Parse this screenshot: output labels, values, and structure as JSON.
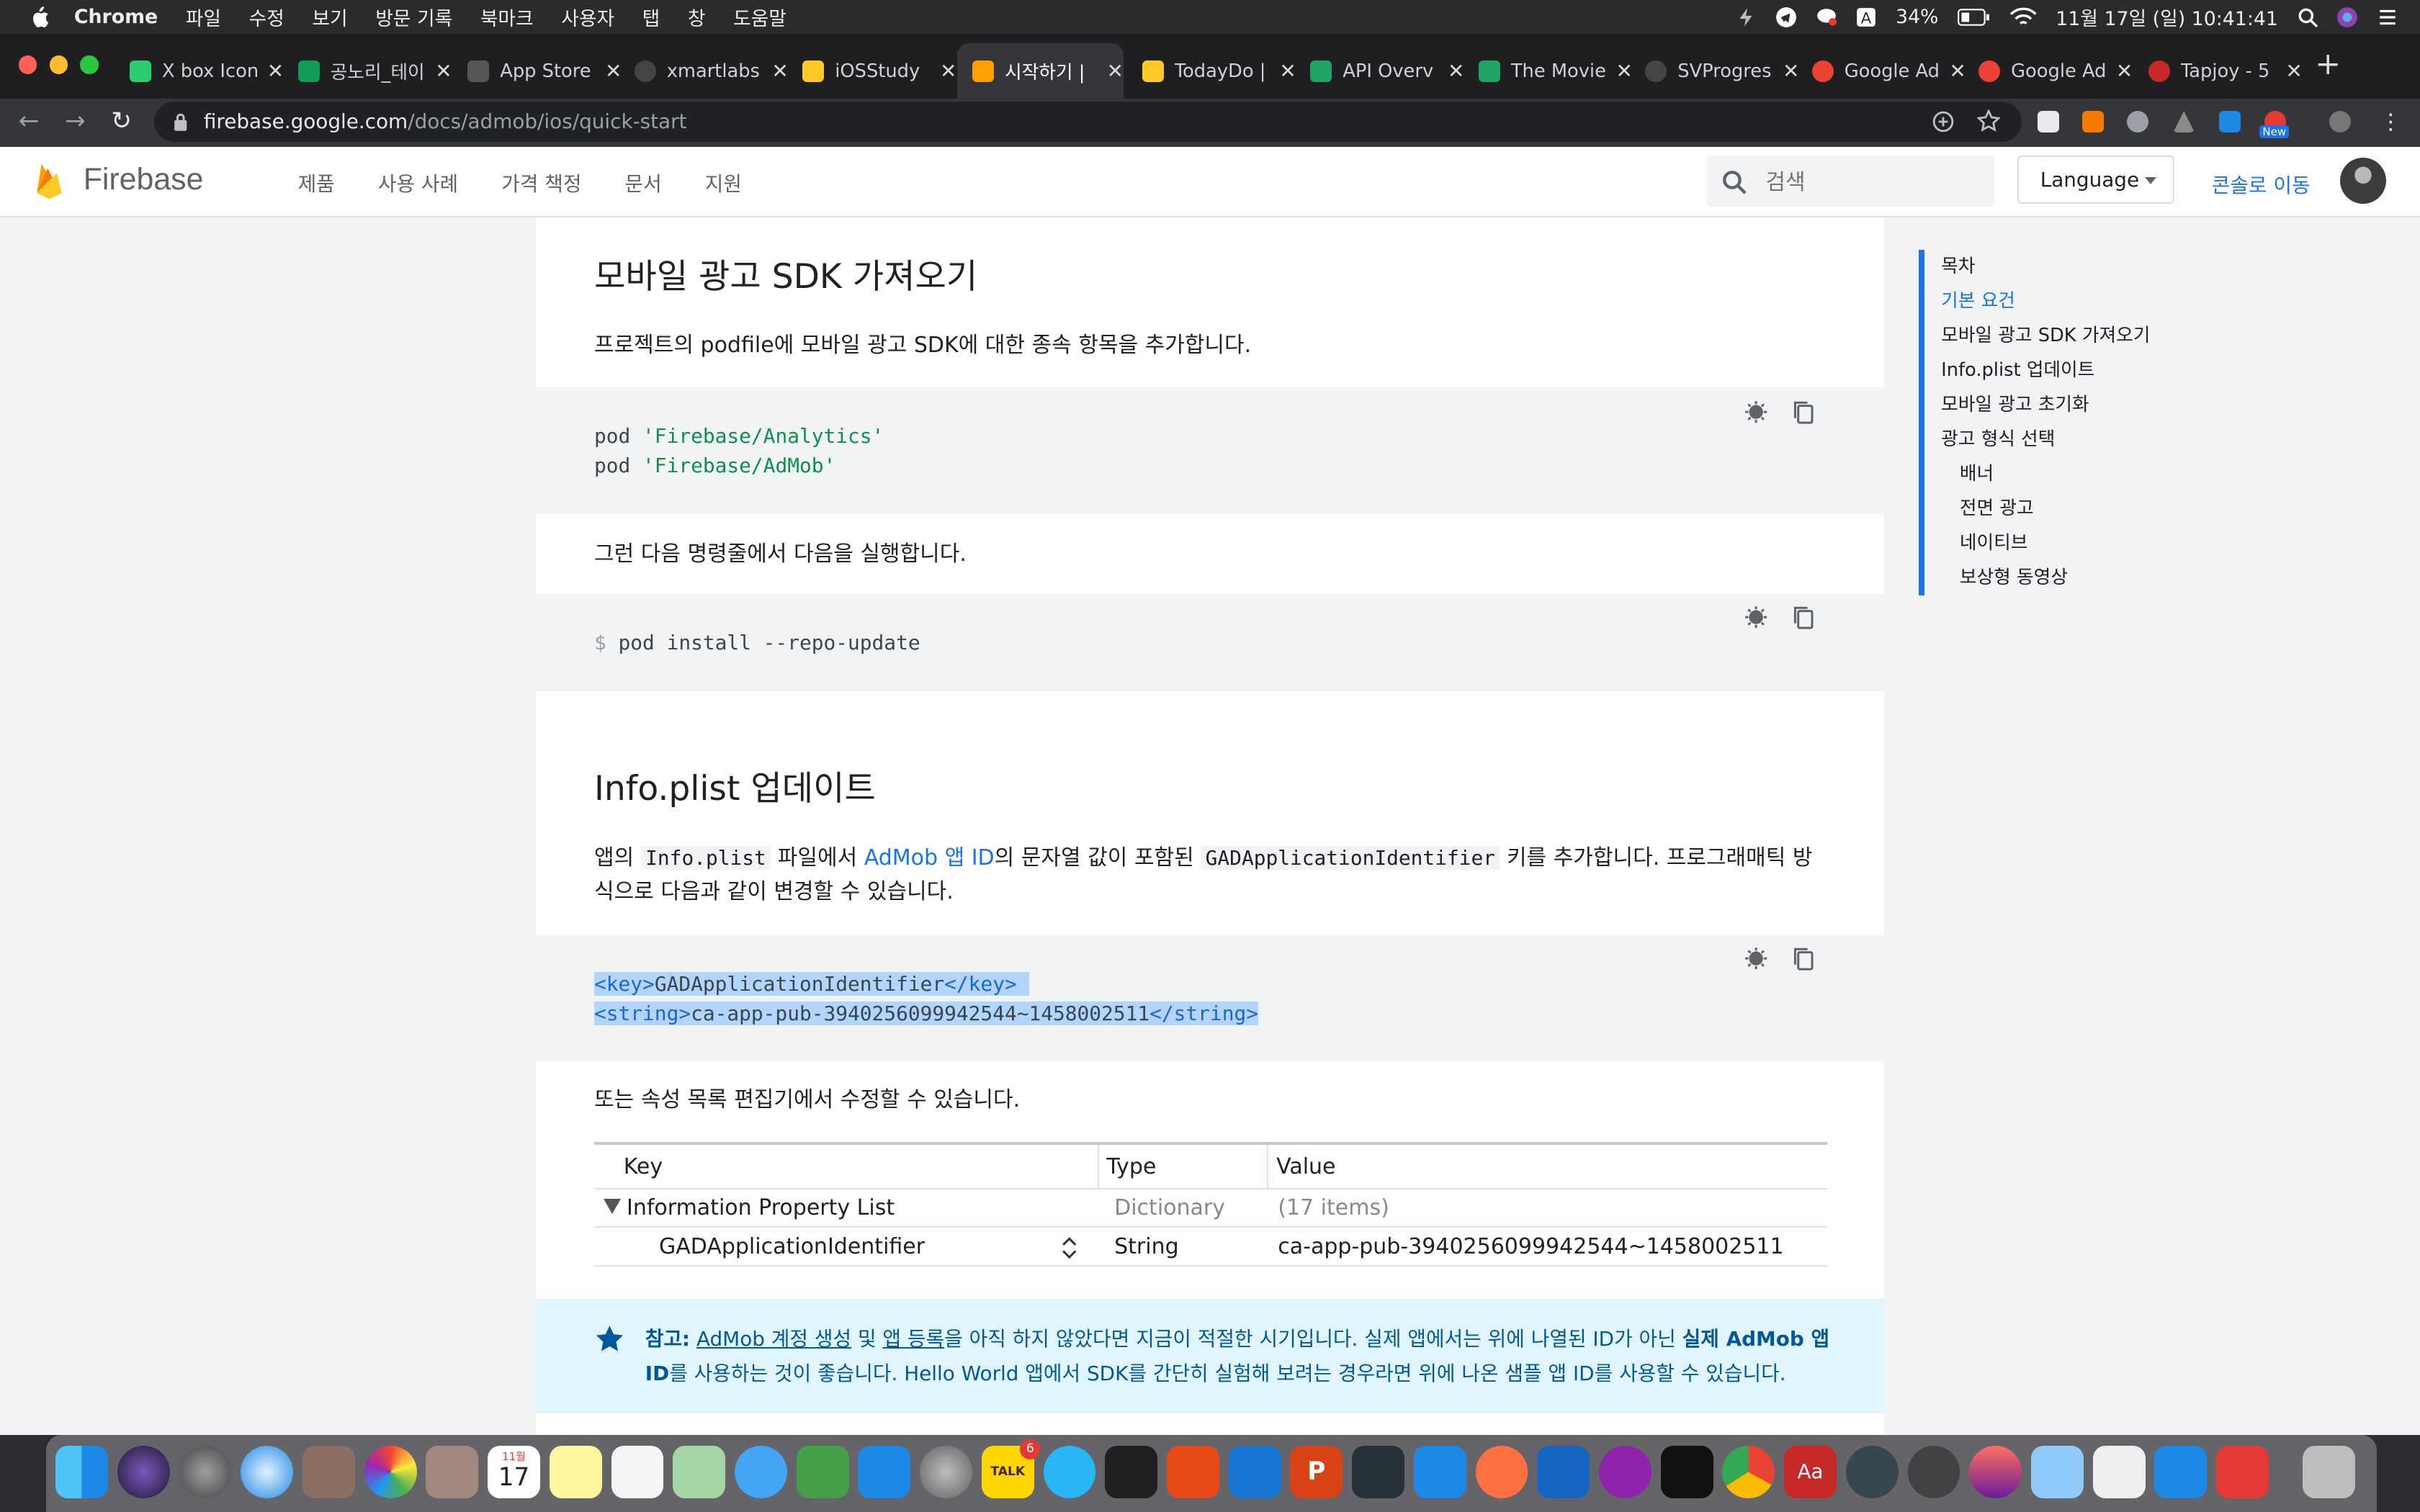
{
  "menubar": {
    "app_name": "Chrome",
    "items": [
      "파일",
      "수정",
      "보기",
      "방문 기록",
      "북마크",
      "사용자",
      "탭",
      "창",
      "도움말"
    ],
    "battery": "34%",
    "datetime": "11월 17일 (일)  10:41:41"
  },
  "tabs": [
    {
      "title": "X box Icon",
      "color": "#2ecc71"
    },
    {
      "title": "공노리_테이",
      "color": "#0f9d58"
    },
    {
      "title": "App Store",
      "color": "#555555"
    },
    {
      "title": "xmartlabs",
      "color": "#444444"
    },
    {
      "title": "iOSStudy",
      "color": "#ffca28"
    },
    {
      "title": "시작하기 |",
      "color": "#ffa000"
    },
    {
      "title": "TodayDo |",
      "color": "#ffca28"
    },
    {
      "title": "API Overv",
      "color": "#21a366"
    },
    {
      "title": "The Movie",
      "color": "#21a366"
    },
    {
      "title": "SVProgres",
      "color": "#444444"
    },
    {
      "title": "Google Ad",
      "color": "#ea4335"
    },
    {
      "title": "Google Ad",
      "color": "#ea4335"
    },
    {
      "title": "Tapjoy - 5",
      "color": "#c62828"
    }
  ],
  "address": {
    "host": "firebase.google.com",
    "path": "/docs/admob/ios/quick-start"
  },
  "header": {
    "brand": "Firebase",
    "nav": [
      "제품",
      "사용 사례",
      "가격 책정",
      "문서",
      "지원"
    ],
    "search_placeholder": "검색",
    "language": "Language",
    "console_link": "콘솔로 이동"
  },
  "article": {
    "sec1_title": "모바일 광고 SDK 가져오기",
    "sec1_text": "프로젝트의 podfile에 모바일 광고 SDK에 대한 종속 항목을 추가합니다.",
    "pod_kw": "pod",
    "pod1": "'Firebase/Analytics'",
    "pod2": "'Firebase/AdMob'",
    "cmd_text": "그런 다음 명령줄에서 다음을 실행합니다.",
    "prompt": "$",
    "cmd": "pod install --repo-update",
    "sec2_title": "Info.plist 업데이트",
    "sec2_p1": "앱의",
    "sec2_code1": "Info.plist",
    "sec2_p2": "파일에서",
    "sec2_link": "AdMob 앱 ID",
    "sec2_p3": "의 문자열 값이 포함된",
    "sec2_code2": "GADApplicationIdentifier",
    "sec2_p4": "키를 추가합니다. 프로그래매틱 방식으로 다음과 같이 변경할 수 있습니다.",
    "xml_key_open": "<key>",
    "xml_key_val": "GADApplicationIdentifier",
    "xml_key_close": "</key>",
    "xml_str_open": "<string>",
    "xml_str_val": "ca-app-pub-3940256099942544~1458002511",
    "xml_str_close": "</string>",
    "plist_text": "또는 속성 목록 편집기에서 수정할 수 있습니다.",
    "table": {
      "headers": [
        "Key",
        "Type",
        "Value"
      ],
      "row1": [
        "Information Property List",
        "Dictionary",
        "(17 items)"
      ],
      "row2": [
        "GADApplicationIdentifier",
        "String",
        "ca-app-pub-3940256099942544~1458002511"
      ]
    },
    "note": {
      "label": "참고:",
      "link1": "AdMob 계정 생성",
      "t1": "및",
      "link2": "앱 등록",
      "t2": "을 아직 하지 않았다면 지금이 적절한 시기입니다. 실제 앱에서는 위에 나열된 ID가 아닌",
      "bold": "실제 AdMob 앱 ID",
      "t3": "를 사용하는 것이 좋습니다. Hello World 앱에서 SDK를 간단히 실험해 보려는 경우라면 위에 나온 샘플 앱 ID를 사용할 수 있습니다."
    }
  },
  "toc": {
    "title": "목차",
    "items": [
      "기본 요건",
      "모바일 광고 SDK 가져오기",
      "Info.plist 업데이트",
      "모바일 광고 초기화",
      "광고 형식 선택"
    ],
    "subitems": [
      "배너",
      "전면 광고",
      "네이티브",
      "보상형 동영상"
    ]
  },
  "dock": {
    "calendar_day": "17",
    "calendar_month": "11월",
    "ppt_letter": "P",
    "dict_label": "Aa",
    "new_badge": "New",
    "talk_label": "TALK",
    "talk_badge": "6"
  },
  "colors": {
    "accent": "#1a73e8",
    "note_bg": "#e1f5fe",
    "code_bg": "#f1f3f4"
  }
}
